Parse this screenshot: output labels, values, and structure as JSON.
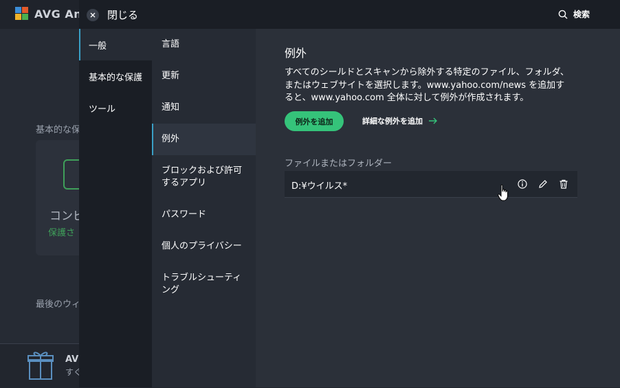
{
  "background_app": {
    "logo_text": "AVG An",
    "section_label": "基本的な保",
    "card_title": "コンピ",
    "card_status": "保護さ",
    "last_scan_label": "最後のウィ",
    "footer_title": "AV",
    "footer_sub": "すぐ"
  },
  "header": {
    "close_label": "閉じる",
    "search_label": "検索"
  },
  "nav_primary": {
    "items": [
      {
        "label": "一般",
        "active": true
      },
      {
        "label": "基本的な保護",
        "active": false
      },
      {
        "label": "ツール",
        "active": false
      }
    ]
  },
  "nav_secondary": {
    "items": [
      {
        "label": "言語",
        "active": false
      },
      {
        "label": "更新",
        "active": false
      },
      {
        "label": "通知",
        "active": false
      },
      {
        "label": "例外",
        "active": true
      },
      {
        "label": "ブロックおよび許可するアプリ",
        "active": false
      },
      {
        "label": "パスワード",
        "active": false
      },
      {
        "label": "個人のプライバシー",
        "active": false
      },
      {
        "label": "トラブルシューティング",
        "active": false
      }
    ]
  },
  "content": {
    "title": "例外",
    "description": "すべてのシールドとスキャンから除外する特定のファイル、フォルダ、またはウェブサイトを選択します。www.yahoo.com/news を追加すると、www.yahoo.com 全体に対して例外が作成されます。",
    "add_button": "例外を追加",
    "advanced_link": "詳細な例外を追加",
    "list_label": "ファイルまたはフォルダー",
    "exceptions": [
      {
        "path": "D:¥ウイルス*"
      }
    ]
  },
  "colors": {
    "accent_green": "#35c37a",
    "active_indicator": "#3aa0c7"
  }
}
